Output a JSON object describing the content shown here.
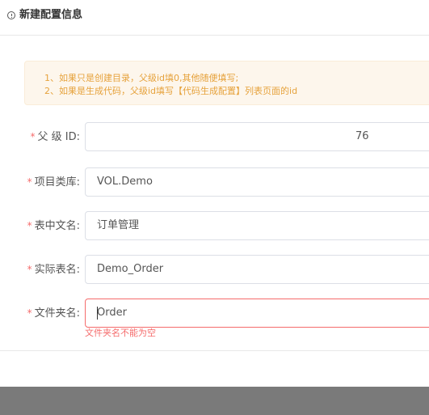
{
  "dialog": {
    "title": "新建配置信息",
    "icon": "info-circle-icon"
  },
  "alert": {
    "line1": "1、如果只是创建目录，父级id填0,其他随便填写;",
    "line2": "2、如果是生成代码，父级id填写【代码生成配置】列表页面的id",
    "color": "#e6a23c"
  },
  "form": {
    "required_mark": "*",
    "parent_id": {
      "label": "父 级 ID:",
      "value": "76"
    },
    "project_class_library": {
      "label": "项目类库:",
      "value": "VOL.Demo"
    },
    "table_chinese_name": {
      "label": "表中文名:",
      "value": "订单管理"
    },
    "actual_table_name": {
      "label": "实际表名:",
      "value": "Demo_Order"
    },
    "folder_name": {
      "label": "文件夹名:",
      "value": "Order",
      "error": "文件夹名不能为空"
    }
  },
  "colors": {
    "required": "#f56c6c",
    "error": "#f56c6c",
    "border": "#dcdfe6"
  }
}
